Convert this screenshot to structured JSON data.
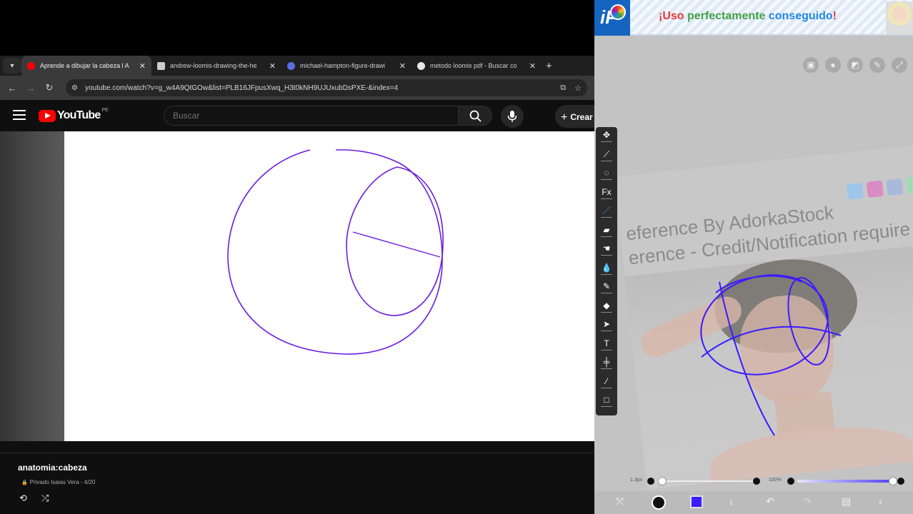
{
  "browser": {
    "tabs": [
      {
        "label": "Aprende a dibujar la cabeza l A",
        "active": true,
        "favicon": "youtube-icon",
        "favicon_color": "#ff0000"
      },
      {
        "label": "andrew-loomis-drawing-the-he",
        "active": false,
        "favicon": "document-icon",
        "favicon_color": "#cccccc"
      },
      {
        "label": "michael-hampton-figure-drawi",
        "active": false,
        "favicon": "archive-icon",
        "favicon_color": "#5b6ee1"
      },
      {
        "label": "metodo loomis pdf - Buscar co",
        "active": false,
        "favicon": "google-icon",
        "favicon_color": "#e8e8e8"
      }
    ],
    "url": "youtube.com/watch?v=g_w4A9QtGOw&list=PLB16JFpusXwq_H3t0kNH9UJUxubDsPXE-&index=4"
  },
  "youtube": {
    "logo_text": "YouTube",
    "country_code": "PE",
    "search_placeholder": "Buscar",
    "create_label": "Crear",
    "playlist_title": "anatomia:cabeza",
    "playlist_meta": "Privado Isaias Vera - 4/20"
  },
  "ibis": {
    "ad": {
      "logo_text": "iP",
      "words": [
        "¡Uso",
        "perfectamente",
        "conseguido",
        "!"
      ]
    },
    "reference_text_1": "eference By AdorkaStock",
    "reference_text_2": "erence - Credit/Notification require",
    "tools": [
      {
        "icon": "move-icon",
        "glyph": "✥"
      },
      {
        "icon": "magic-wand-icon",
        "glyph": "⟋"
      },
      {
        "icon": "lasso-icon",
        "glyph": "◌"
      },
      {
        "icon": "filter-icon",
        "glyph": "Fx"
      },
      {
        "icon": "brush-icon",
        "glyph": "／",
        "selected": true
      },
      {
        "icon": "eraser-icon",
        "glyph": "▰"
      },
      {
        "icon": "smudge-icon",
        "glyph": "☚"
      },
      {
        "icon": "blur-icon",
        "glyph": "💧"
      },
      {
        "icon": "special-icon",
        "glyph": "✎"
      },
      {
        "icon": "fill-icon",
        "glyph": "◆"
      },
      {
        "icon": "select-icon",
        "glyph": "➤"
      },
      {
        "icon": "text-icon",
        "glyph": "T"
      },
      {
        "icon": "frame-divider-icon",
        "glyph": "╪"
      },
      {
        "icon": "eyedropper-icon",
        "glyph": "⁄"
      },
      {
        "icon": "canvas-icon",
        "glyph": "□"
      }
    ],
    "brush_size_label": "1.3px",
    "opacity_label": "100%",
    "brush_size": 0.05,
    "opacity": 1.0,
    "current_color": "#3b1bff"
  }
}
